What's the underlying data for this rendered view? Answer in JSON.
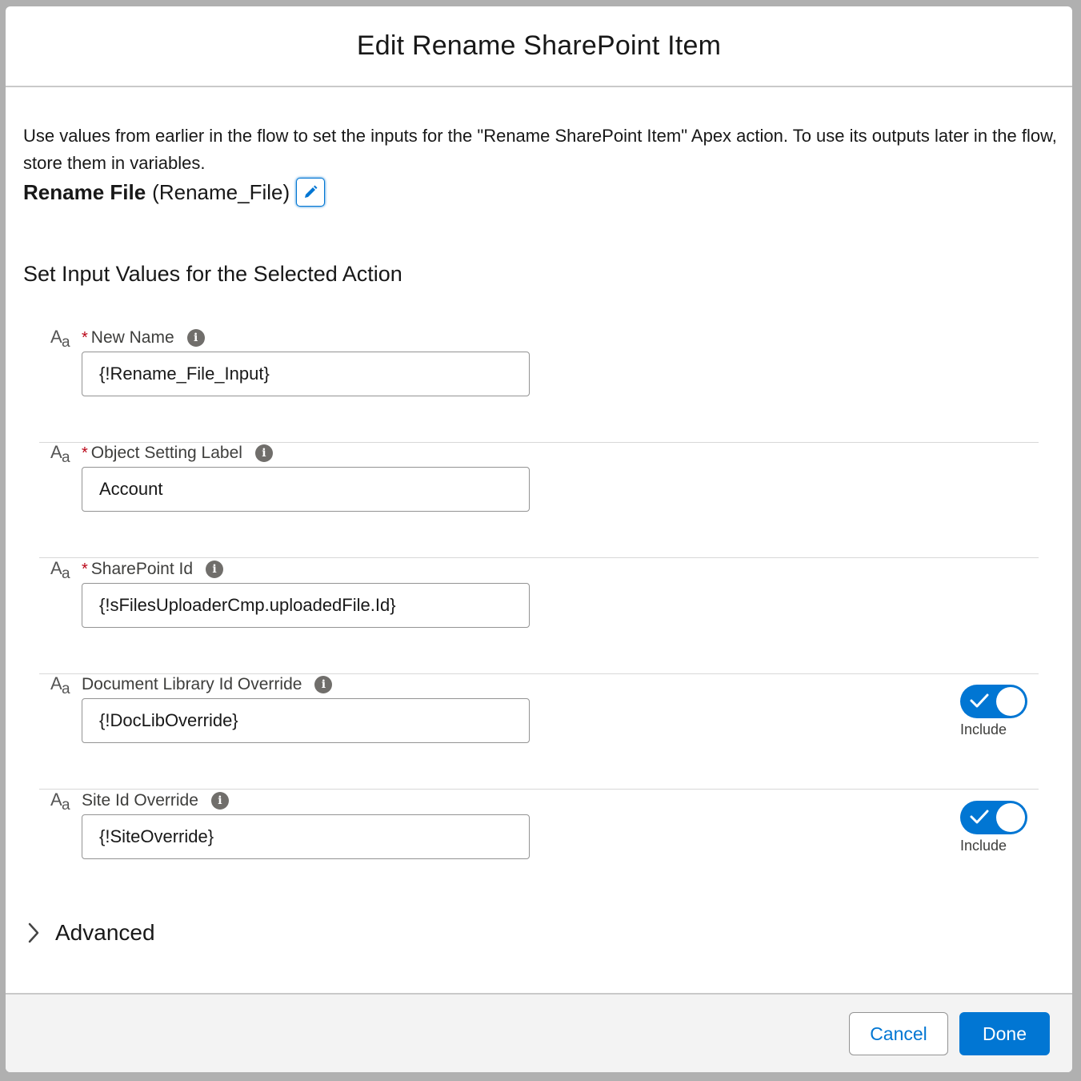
{
  "modal": {
    "title": "Edit Rename SharePoint Item"
  },
  "intro": "Use values from earlier in the flow to set the inputs for the \"Rename SharePoint Item\" Apex action. To use its outputs later in the flow, store them in variables.",
  "action": {
    "label": "Rename File",
    "api_name": "(Rename_File)"
  },
  "section_title": "Set Input Values for the Selected Action",
  "params": [
    {
      "label": "New Name",
      "required": true,
      "value": "{!Rename_File_Input}",
      "icon": "text-type-icon"
    },
    {
      "label": "Object Setting Label",
      "required": true,
      "value": "Account",
      "icon": "text-type-icon"
    },
    {
      "label": "SharePoint Id",
      "required": true,
      "value": "{!sFilesUploaderCmp.uploadedFile.Id}",
      "icon": "text-type-icon"
    },
    {
      "label": "Document Library Id Override",
      "required": false,
      "value": "{!DocLibOverride}",
      "include": true,
      "include_label": "Include",
      "icon": "text-type-icon"
    },
    {
      "label": "Site Id Override",
      "required": false,
      "value": "{!SiteOverride}",
      "include": true,
      "include_label": "Include",
      "icon": "text-type-icon"
    }
  ],
  "required_marker": "*",
  "advanced_label": "Advanced",
  "footer": {
    "cancel_label": "Cancel",
    "done_label": "Done"
  },
  "colors": {
    "brand": "#0176d3",
    "required": "#ba0517"
  }
}
